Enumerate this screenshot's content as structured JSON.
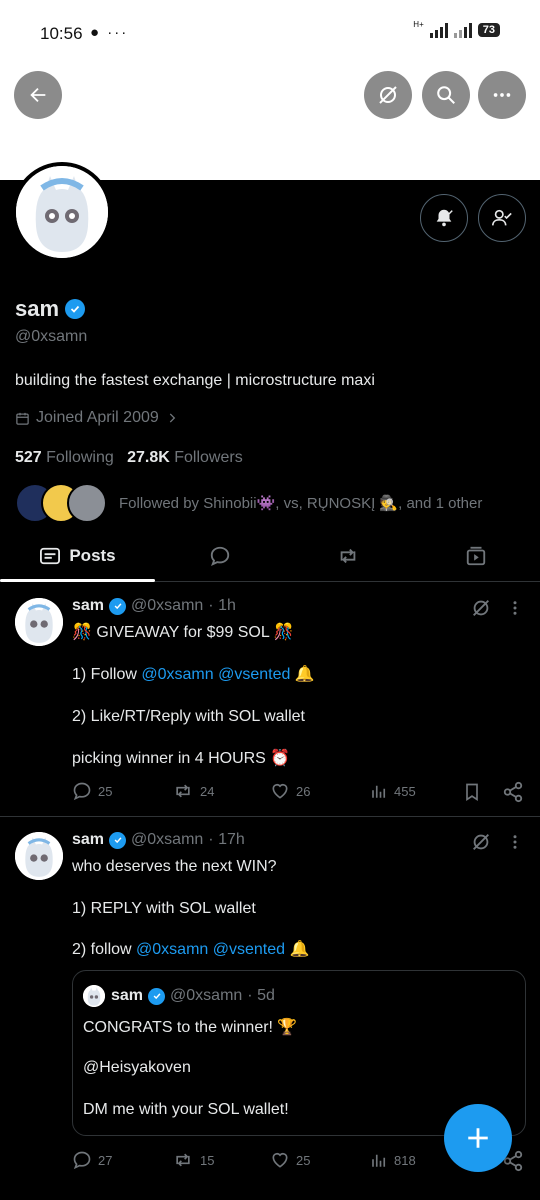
{
  "status_bar": {
    "time": "10:56",
    "left_icons": "● ···",
    "battery": "73",
    "network": "H+"
  },
  "profile": {
    "name": "sam",
    "handle": "@0xsamn",
    "bio": "building the fastest exchange | microstructure maxi",
    "joined": "Joined April 2009",
    "following_count": "527",
    "following_label": "Following",
    "followers_count": "27.8K",
    "followers_label": "Followers",
    "followed_by": "Followed by Shinobii👾, vs, RŲNOSKĮ 🕵, and 1 other"
  },
  "tabs": {
    "posts": "Posts"
  },
  "posts": [
    {
      "name": "sam",
      "handle": "@0xsamn",
      "time": "· 1h",
      "line1": "🎊 GIVEAWAY for $99 SOL 🎊",
      "line2_prefix": "1) Follow ",
      "line2_link1": "@0xsamn",
      "line2_link2": "@vsented",
      "line2_suffix": " 🔔",
      "line3": "2) Like/RT/Reply with SOL wallet",
      "line4": "picking winner in 4 HOURS ⏰",
      "replies": "25",
      "reposts": "24",
      "likes": "26",
      "views": "455"
    },
    {
      "name": "sam",
      "handle": "@0xsamn",
      "time": "· 17h",
      "line1": "who deserves the next WIN?",
      "line2": "1) REPLY with SOL wallet",
      "line3_prefix": "2) follow ",
      "line3_link1": "@0xsamn",
      "line3_link2": "@vsented",
      "line3_suffix": " 🔔",
      "quote": {
        "name": "sam",
        "handle": "@0xsamn",
        "time": "· 5d",
        "line1": "CONGRATS to the winner! 🏆",
        "line2": "@Heisyakoven",
        "line3": "DM me with your SOL wallet!"
      },
      "replies": "27",
      "reposts": "15",
      "likes": "25",
      "views": "818"
    }
  ],
  "colors": {
    "accent": "#1d9bf0",
    "muted": "#71767b",
    "text": "#e7e9ea",
    "bg": "#000000",
    "border": "#2f3336"
  }
}
